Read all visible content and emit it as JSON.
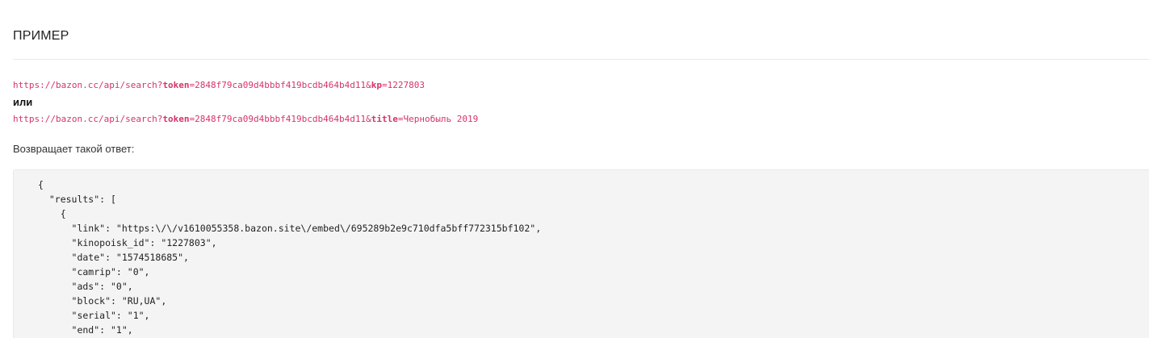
{
  "section": {
    "title": "ПРИМЕР"
  },
  "examples": {
    "url1": {
      "base": "https://bazon.cc/api/search?",
      "p1_name": "token",
      "p1_value": "=2848f79ca09d4bbbf419bcdb464b4d11&",
      "p2_name": "kp",
      "p2_value": "=1227803"
    },
    "or_label": "или",
    "url2": {
      "base": "https://bazon.cc/api/search?",
      "p1_name": "token",
      "p1_value": "=2848f79ca09d4bbbf419bcdb464b4d11&",
      "p2_name": "title",
      "p2_value": "=Чернобыль 2019"
    },
    "returns_label": "Возвращает такой ответ:"
  },
  "response": {
    "lines": [
      "{",
      "  \"results\": [",
      "    {",
      "      \"link\": \"https:\\/\\/v1610055358.bazon.site\\/embed\\/695289b2e9c710dfa5bff772315bf102\",",
      "      \"kinopoisk_id\": \"1227803\",",
      "      \"date\": \"1574518685\",",
      "      \"camrip\": \"0\",",
      "      \"ads\": \"0\",",
      "      \"block\": \"RU,UA\",",
      "      \"serial\": \"1\",",
      "      \"end\": \"1\","
    ]
  }
}
